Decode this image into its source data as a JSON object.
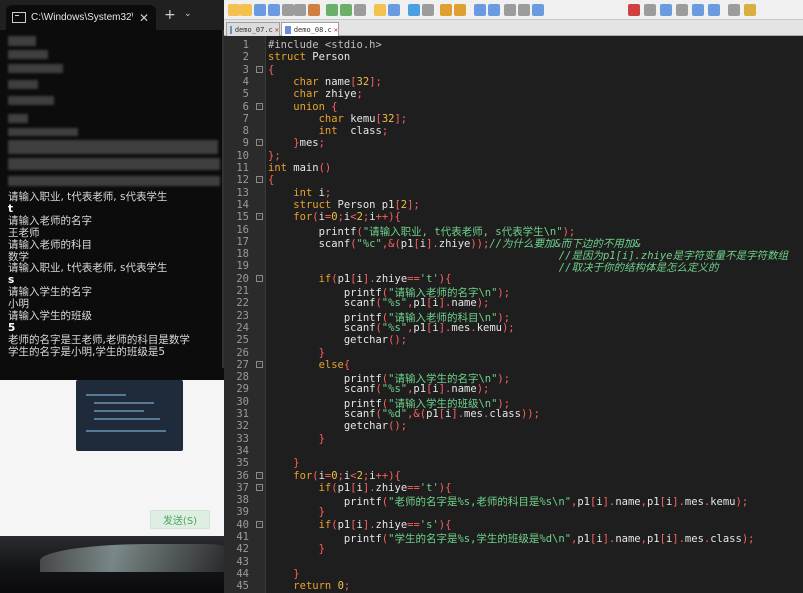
{
  "cmd": {
    "tab_title": "C:\\Windows\\System32\\cmd.exe",
    "close_glyph": "✕",
    "newtab_glyph": "+",
    "dropdown_glyph": "⌄",
    "output_lines": [
      {
        "text": "请输入职业, t代表老师, s代表学生",
        "bold": false
      },
      {
        "text": "t",
        "bold": true
      },
      {
        "text": "请输入老师的名字",
        "bold": false
      },
      {
        "text": "王老师",
        "bold": false
      },
      {
        "text": "请输入老师的科目",
        "bold": false
      },
      {
        "text": "数学",
        "bold": false
      },
      {
        "text": "请输入职业, t代表老师, s代表学生",
        "bold": false
      },
      {
        "text": "s",
        "bold": true
      },
      {
        "text": "请输入学生的名字",
        "bold": false
      },
      {
        "text": "小明",
        "bold": false
      },
      {
        "text": "请输入学生的班级",
        "bold": false
      },
      {
        "text": "5",
        "bold": true
      },
      {
        "text": "老师的名字是王老师,老师的科目是数学",
        "bold": false
      },
      {
        "text": "学生的名字是小明,学生的班级是5",
        "bold": false
      }
    ]
  },
  "background_app": {
    "send_button": "发送(S)"
  },
  "editor": {
    "tabs": [
      {
        "label": "demo_07.c",
        "active": false
      },
      {
        "label": "demo_08.c",
        "active": true
      }
    ],
    "lines": [
      [
        [
          "pp",
          "#include <stdio.h>"
        ]
      ],
      [
        [
          "kw",
          "struct"
        ],
        [
          "id",
          " Person"
        ]
      ],
      [
        [
          "op",
          "{"
        ]
      ],
      [
        [
          "id",
          "    "
        ],
        [
          "ty",
          "char"
        ],
        [
          "id",
          " name"
        ],
        [
          "op",
          "["
        ],
        [
          "nm",
          "32"
        ],
        [
          "op",
          "];"
        ]
      ],
      [
        [
          "id",
          "    "
        ],
        [
          "ty",
          "char"
        ],
        [
          "id",
          " zhiye"
        ],
        [
          "op",
          ";"
        ]
      ],
      [
        [
          "id",
          "    "
        ],
        [
          "kw",
          "union"
        ],
        [
          "id",
          " "
        ],
        [
          "op",
          "{"
        ]
      ],
      [
        [
          "id",
          "        "
        ],
        [
          "ty",
          "char"
        ],
        [
          "id",
          " kemu"
        ],
        [
          "op",
          "["
        ],
        [
          "nm",
          "32"
        ],
        [
          "op",
          "];"
        ]
      ],
      [
        [
          "id",
          "        "
        ],
        [
          "ty",
          "int"
        ],
        [
          "id",
          "  class"
        ],
        [
          "op",
          ";"
        ]
      ],
      [
        [
          "id",
          "    "
        ],
        [
          "op",
          "}"
        ],
        [
          "id",
          "mes"
        ],
        [
          "op",
          ";"
        ]
      ],
      [
        [
          "op",
          "};"
        ]
      ],
      [
        [
          "ty",
          "int"
        ],
        [
          "id",
          " main"
        ],
        [
          "op",
          "()"
        ]
      ],
      [
        [
          "op",
          "{"
        ]
      ],
      [
        [
          "id",
          "    "
        ],
        [
          "ty",
          "int"
        ],
        [
          "id",
          " i"
        ],
        [
          "op",
          ";"
        ]
      ],
      [
        [
          "id",
          "    "
        ],
        [
          "kw",
          "struct"
        ],
        [
          "id",
          " Person p1"
        ],
        [
          "op",
          "["
        ],
        [
          "nm",
          "2"
        ],
        [
          "op",
          "];"
        ]
      ],
      [
        [
          "id",
          "    "
        ],
        [
          "kw",
          "for"
        ],
        [
          "op",
          "("
        ],
        [
          "id",
          "i"
        ],
        [
          "op",
          "="
        ],
        [
          "nm",
          "0"
        ],
        [
          "op",
          ";"
        ],
        [
          "id",
          "i"
        ],
        [
          "op",
          "<"
        ],
        [
          "nm",
          "2"
        ],
        [
          "op",
          ";"
        ],
        [
          "id",
          "i"
        ],
        [
          "op",
          "++){"
        ]
      ],
      [
        [
          "id",
          "        printf"
        ],
        [
          "op",
          "("
        ],
        [
          "st",
          "\"请输入职业, t代表老师, s代表学生\\n\""
        ],
        [
          "op",
          ");"
        ]
      ],
      [
        [
          "id",
          "        scanf"
        ],
        [
          "op",
          "("
        ],
        [
          "st",
          "\"%c\""
        ],
        [
          "op",
          ",&("
        ],
        [
          "id",
          "p1"
        ],
        [
          "op",
          "["
        ],
        [
          "id",
          "i"
        ],
        [
          "op",
          "]."
        ],
        [
          "id",
          "zhiye"
        ],
        [
          "op",
          "));"
        ],
        [
          "cm",
          "//为什么要加&而下边的不用加&"
        ]
      ],
      [
        [
          "id",
          "                                              "
        ],
        [
          "cm",
          "//是因为p1[i].zhiye是字符变量不是字符数组"
        ]
      ],
      [
        [
          "id",
          "                                              "
        ],
        [
          "cm",
          "//取决于你的结构体是怎么定义的"
        ]
      ],
      [
        [
          "id",
          "        "
        ],
        [
          "kw",
          "if"
        ],
        [
          "op",
          "("
        ],
        [
          "id",
          "p1"
        ],
        [
          "op",
          "["
        ],
        [
          "id",
          "i"
        ],
        [
          "op",
          "]."
        ],
        [
          "id",
          "zhiye"
        ],
        [
          "op",
          "=="
        ],
        [
          "st",
          "'t'"
        ],
        [
          "op",
          "){"
        ]
      ],
      [
        [
          "id",
          "            printf"
        ],
        [
          "op",
          "("
        ],
        [
          "st",
          "\"请输入老师的名字\\n\""
        ],
        [
          "op",
          ");"
        ]
      ],
      [
        [
          "id",
          "            scanf"
        ],
        [
          "op",
          "("
        ],
        [
          "st",
          "\"%s\""
        ],
        [
          "op",
          ","
        ],
        [
          "id",
          "p1"
        ],
        [
          "op",
          "["
        ],
        [
          "id",
          "i"
        ],
        [
          "op",
          "]."
        ],
        [
          "id",
          "name"
        ],
        [
          "op",
          ");"
        ]
      ],
      [
        [
          "id",
          "            printf"
        ],
        [
          "op",
          "("
        ],
        [
          "st",
          "\"请输入老师的科目\\n\""
        ],
        [
          "op",
          ");"
        ]
      ],
      [
        [
          "id",
          "            scanf"
        ],
        [
          "op",
          "("
        ],
        [
          "st",
          "\"%s\""
        ],
        [
          "op",
          ","
        ],
        [
          "id",
          "p1"
        ],
        [
          "op",
          "["
        ],
        [
          "id",
          "i"
        ],
        [
          "op",
          "]."
        ],
        [
          "id",
          "mes"
        ],
        [
          "op",
          "."
        ],
        [
          "id",
          "kemu"
        ],
        [
          "op",
          ");"
        ]
      ],
      [
        [
          "id",
          "            getchar"
        ],
        [
          "op",
          "();"
        ]
      ],
      [
        [
          "id",
          "        "
        ],
        [
          "op",
          "}"
        ]
      ],
      [
        [
          "id",
          "        "
        ],
        [
          "kw",
          "else"
        ],
        [
          "op",
          "{"
        ]
      ],
      [
        [
          "id",
          "            printf"
        ],
        [
          "op",
          "("
        ],
        [
          "st",
          "\"请输入学生的名字\\n\""
        ],
        [
          "op",
          ");"
        ]
      ],
      [
        [
          "id",
          "            scanf"
        ],
        [
          "op",
          "("
        ],
        [
          "st",
          "\"%s\""
        ],
        [
          "op",
          ","
        ],
        [
          "id",
          "p1"
        ],
        [
          "op",
          "["
        ],
        [
          "id",
          "i"
        ],
        [
          "op",
          "]."
        ],
        [
          "id",
          "name"
        ],
        [
          "op",
          ");"
        ]
      ],
      [
        [
          "id",
          "            printf"
        ],
        [
          "op",
          "("
        ],
        [
          "st",
          "\"请输入学生的班级\\n\""
        ],
        [
          "op",
          ");"
        ]
      ],
      [
        [
          "id",
          "            scanf"
        ],
        [
          "op",
          "("
        ],
        [
          "st",
          "\"%d\""
        ],
        [
          "op",
          ",&("
        ],
        [
          "id",
          "p1"
        ],
        [
          "op",
          "["
        ],
        [
          "id",
          "i"
        ],
        [
          "op",
          "]."
        ],
        [
          "id",
          "mes"
        ],
        [
          "op",
          "."
        ],
        [
          "id",
          "class"
        ],
        [
          "op",
          "));"
        ]
      ],
      [
        [
          "id",
          "            getchar"
        ],
        [
          "op",
          "();"
        ]
      ],
      [
        [
          "id",
          "        "
        ],
        [
          "op",
          "}"
        ]
      ],
      [
        [
          "id",
          ""
        ]
      ],
      [
        [
          "id",
          "    "
        ],
        [
          "op",
          "}"
        ]
      ],
      [
        [
          "id",
          "    "
        ],
        [
          "kw",
          "for"
        ],
        [
          "op",
          "("
        ],
        [
          "id",
          "i"
        ],
        [
          "op",
          "="
        ],
        [
          "nm",
          "0"
        ],
        [
          "op",
          ";"
        ],
        [
          "id",
          "i"
        ],
        [
          "op",
          "<"
        ],
        [
          "nm",
          "2"
        ],
        [
          "op",
          ";"
        ],
        [
          "id",
          "i"
        ],
        [
          "op",
          "++){"
        ]
      ],
      [
        [
          "id",
          "        "
        ],
        [
          "kw",
          "if"
        ],
        [
          "op",
          "("
        ],
        [
          "id",
          "p1"
        ],
        [
          "op",
          "["
        ],
        [
          "id",
          "i"
        ],
        [
          "op",
          "]."
        ],
        [
          "id",
          "zhiye"
        ],
        [
          "op",
          "=="
        ],
        [
          "st",
          "'t'"
        ],
        [
          "op",
          "){"
        ]
      ],
      [
        [
          "id",
          "            printf"
        ],
        [
          "op",
          "("
        ],
        [
          "st",
          "\"老师的名字是%s,老师的科目是%s\\n\""
        ],
        [
          "op",
          ","
        ],
        [
          "id",
          "p1"
        ],
        [
          "op",
          "["
        ],
        [
          "id",
          "i"
        ],
        [
          "op",
          "]."
        ],
        [
          "id",
          "name"
        ],
        [
          "op",
          ","
        ],
        [
          "id",
          "p1"
        ],
        [
          "op",
          "["
        ],
        [
          "id",
          "i"
        ],
        [
          "op",
          "]."
        ],
        [
          "id",
          "mes"
        ],
        [
          "op",
          "."
        ],
        [
          "id",
          "kemu"
        ],
        [
          "op",
          ");"
        ]
      ],
      [
        [
          "id",
          "        "
        ],
        [
          "op",
          "}"
        ]
      ],
      [
        [
          "id",
          "        "
        ],
        [
          "kw",
          "if"
        ],
        [
          "op",
          "("
        ],
        [
          "id",
          "p1"
        ],
        [
          "op",
          "["
        ],
        [
          "id",
          "i"
        ],
        [
          "op",
          "]."
        ],
        [
          "id",
          "zhiye"
        ],
        [
          "op",
          "=="
        ],
        [
          "st",
          "'s'"
        ],
        [
          "op",
          "){"
        ]
      ],
      [
        [
          "id",
          "            printf"
        ],
        [
          "op",
          "("
        ],
        [
          "st",
          "\"学生的名字是%s,学生的班级是%d\\n\""
        ],
        [
          "op",
          ","
        ],
        [
          "id",
          "p1"
        ],
        [
          "op",
          "["
        ],
        [
          "id",
          "i"
        ],
        [
          "op",
          "]."
        ],
        [
          "id",
          "name"
        ],
        [
          "op",
          ","
        ],
        [
          "id",
          "p1"
        ],
        [
          "op",
          "["
        ],
        [
          "id",
          "i"
        ],
        [
          "op",
          "]."
        ],
        [
          "id",
          "mes"
        ],
        [
          "op",
          "."
        ],
        [
          "id",
          "class"
        ],
        [
          "op",
          ");"
        ]
      ],
      [
        [
          "id",
          "        "
        ],
        [
          "op",
          "}"
        ]
      ],
      [
        [
          "id",
          ""
        ]
      ],
      [
        [
          "id",
          "    "
        ],
        [
          "op",
          "}"
        ]
      ],
      [
        [
          "id",
          "    "
        ],
        [
          "kw",
          "return"
        ],
        [
          "id",
          " "
        ],
        [
          "nm",
          "0"
        ],
        [
          "op",
          ";"
        ]
      ]
    ],
    "line_numbers": [
      "1",
      "2",
      "3",
      "4",
      "5",
      "6",
      "7",
      "8",
      "9",
      "10",
      "11",
      "12",
      "13",
      "14",
      "15",
      "16",
      "17",
      "18",
      "19",
      "20",
      "21",
      "22",
      "23",
      "24",
      "25",
      "26",
      "27",
      "28",
      "29",
      "30",
      "31",
      "32",
      "33",
      "34",
      "35",
      "36",
      "37",
      "38",
      "39",
      "40",
      "41",
      "42",
      "43",
      "44",
      "45"
    ],
    "fold_markers": {
      "3": "-",
      "6": "-",
      "9": "-",
      "12": "-",
      "15": "-",
      "20": "-",
      "27": "-",
      "36": "-",
      "37": "-",
      "40": "-"
    }
  }
}
